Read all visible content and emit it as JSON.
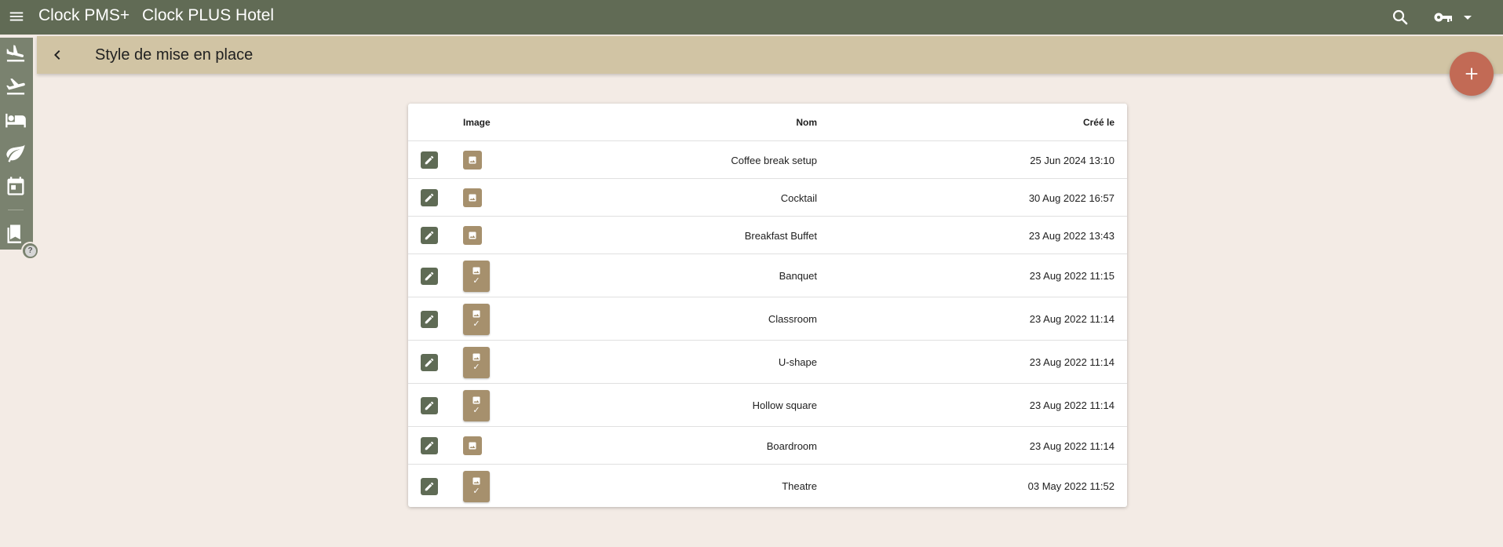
{
  "app": {
    "name": "Clock PMS+",
    "hotel": "Clock PLUS Hotel"
  },
  "icons": {
    "menu": "menu-icon",
    "search": "search-icon",
    "account": "key-icon",
    "account_dropdown": "caret-down-icon",
    "back": "chevron-left-icon",
    "add": "plus-icon",
    "help": "help-icon"
  },
  "rail": {
    "items": [
      "arrivals-icon",
      "departures-icon",
      "rooms-icon",
      "leaf-icon",
      "calendar-icon",
      "books-icon"
    ],
    "help_label": "?"
  },
  "page": {
    "title": "Style de mise en place"
  },
  "colors": {
    "topbar": "#616b55",
    "header": "#d1c4a4",
    "background": "#f3ebe5",
    "fab": "#c26a55",
    "edit_button": "#5f6b55",
    "thumbnail": "#a6906d"
  },
  "table": {
    "headers": {
      "image": "Image",
      "nom": "Nom",
      "cree_le": "Créé le"
    },
    "check_mark": "✓",
    "rows": [
      {
        "nom": "Coffee break setup",
        "date": "25 Jun 2024 13:10",
        "has_image": false
      },
      {
        "nom": "Cocktail",
        "date": "30 Aug 2022 16:57",
        "has_image": false
      },
      {
        "nom": "Breakfast Buffet",
        "date": "23 Aug 2022 13:43",
        "has_image": false
      },
      {
        "nom": "Banquet",
        "date": "23 Aug 2022 11:15",
        "has_image": true
      },
      {
        "nom": "Classroom",
        "date": "23 Aug 2022 11:14",
        "has_image": true
      },
      {
        "nom": "U-shape",
        "date": "23 Aug 2022 11:14",
        "has_image": true
      },
      {
        "nom": "Hollow square",
        "date": "23 Aug 2022 11:14",
        "has_image": true
      },
      {
        "nom": "Boardroom",
        "date": "23 Aug 2022 11:14",
        "has_image": false
      },
      {
        "nom": "Theatre",
        "date": "03 May 2022 11:52",
        "has_image": true
      }
    ]
  }
}
